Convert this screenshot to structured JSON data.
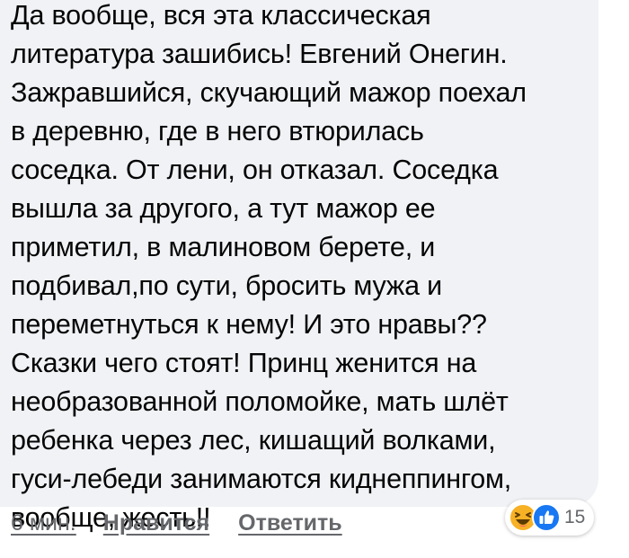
{
  "comment": {
    "text": "Да вообще, вся эта классическая\nлитература зашибись! Евгений Онегин.\nЗажравшийся, скучающий мажор поехал\nв деревню, где в него втюрилась\nсоседка. От лени, он отказал. Соседка\nвышла за другого, а тут мажор ее\nприметил, в малиновом берете, и\nподбивал,по сути, бросить мужа и\nпереметнуться к нему! И это нравы??\nСказки чего стоят! Принц женится на\nнеобразованной поломойке, мать шлёт\nребенка через лес, кишащий волками,\nгуси-лебеди занимаются киднеппингом,\nвообще, жесть!!"
  },
  "actions": {
    "time": "6 мин.",
    "like": "Нравится",
    "reply": "Ответить"
  },
  "reactions": {
    "count": "15",
    "icons": [
      "haha-icon",
      "like-icon"
    ]
  },
  "colors": {
    "bubble": "#f0f2f5",
    "text": "#050505",
    "meta": "#65676b",
    "like_blue": "#1877f2",
    "haha_yellow": "#f7b125"
  }
}
